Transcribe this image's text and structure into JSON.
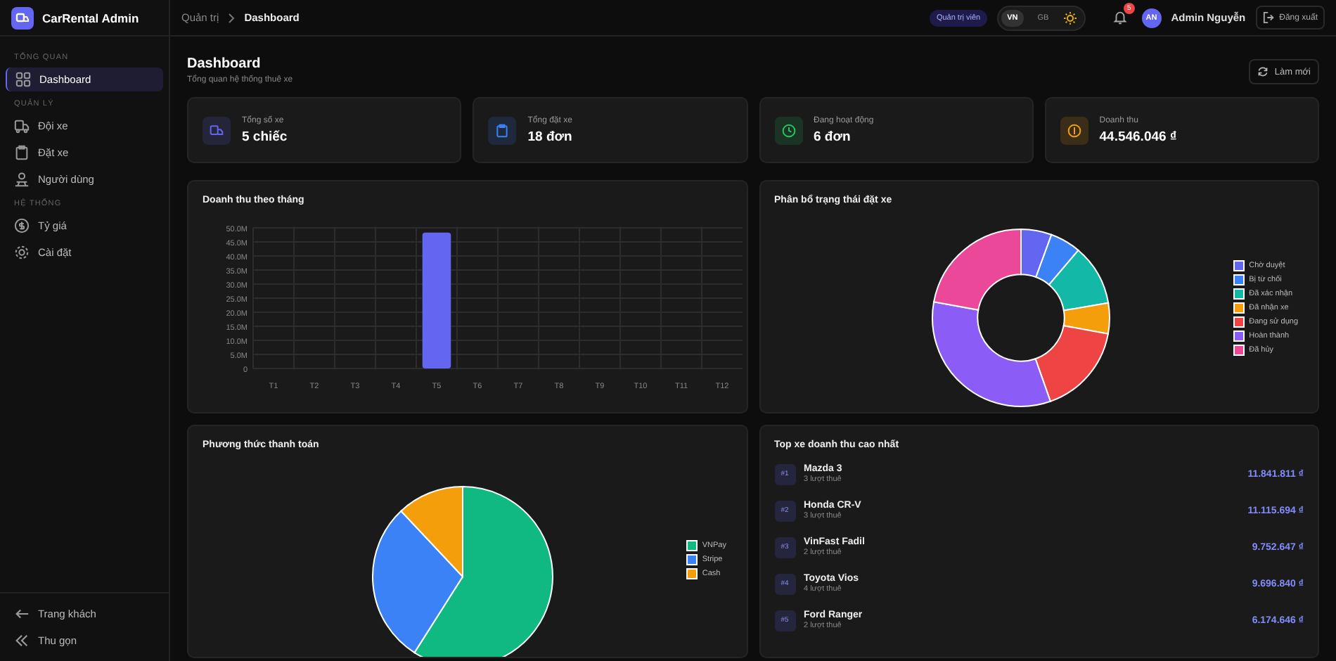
{
  "sidebar": {
    "brand": "CarRental Admin",
    "sections": [
      {
        "title": "TỔNG QUAN",
        "items": [
          {
            "label": "Dashboard",
            "selected": true
          }
        ]
      },
      {
        "title": "QUẢN LÝ",
        "items": [
          {
            "label": "Đội xe",
            "selected": false
          },
          {
            "label": "Đặt xe",
            "selected": false
          },
          {
            "label": "Người dùng",
            "selected": false
          }
        ]
      },
      {
        "title": "HỆ THỐNG",
        "items": [
          {
            "label": "Tỷ giá",
            "selected": false
          },
          {
            "label": "Cài đặt",
            "selected": false
          }
        ]
      }
    ],
    "footer": [
      "Trang khách",
      "Thu gọn"
    ]
  },
  "breadcrumb": [
    "Quản trị",
    "Dashboard"
  ],
  "header": {
    "role": "Quản trị viên",
    "languages": [
      {
        "label": "VN",
        "selected": true
      },
      {
        "label": "GB",
        "selected": false
      }
    ],
    "notifications": "5",
    "avatar": "AN",
    "user": "Admin Nguyễn",
    "logout": "Đăng xuất"
  },
  "page": {
    "title": "Dashboard",
    "subtitle": "Tổng quan hệ thống thuê xe",
    "refresh": "Làm mới"
  },
  "stats": [
    {
      "label": "Tổng số xe",
      "value": "5 chiếc",
      "color": "#6366f1"
    },
    {
      "label": "Tổng đặt xe",
      "value": "18 đơn",
      "color": "#3b82f6"
    },
    {
      "label": "Đang hoạt động",
      "value": "6 đơn",
      "color": "#22c55e"
    },
    {
      "label": "Doanh thu",
      "value": "44.546.046 ₫",
      "color": "#f59e0b"
    }
  ],
  "revenue_chart": {
    "chart_data": {
      "type": "bar",
      "title": "Doanh thu theo tháng",
      "grid": true,
      "categories": [
        "T1",
        "T2",
        "T3",
        "T4",
        "T5",
        "T6",
        "T7",
        "T8",
        "T9",
        "T10",
        "T11",
        "T12"
      ],
      "values": [
        0,
        0,
        0,
        0,
        48.3,
        0,
        0,
        0,
        0,
        0,
        0,
        0
      ],
      "ylim": [
        0,
        50
      ],
      "yticks": [
        {
          "value": 0,
          "label": "0"
        },
        {
          "value": 5,
          "label": "5.0M"
        },
        {
          "value": 10,
          "label": "10.0M"
        },
        {
          "value": 15,
          "label": "15.0M"
        },
        {
          "value": 20,
          "label": "20.0M"
        },
        {
          "value": 25,
          "label": "25.0M"
        },
        {
          "value": 30,
          "label": "30.0M"
        },
        {
          "value": 35,
          "label": "35.0M"
        },
        {
          "value": 40,
          "label": "40.0M"
        },
        {
          "value": 45,
          "label": "45.0M"
        },
        {
          "value": 50,
          "label": "50.0M"
        }
      ]
    }
  },
  "status_chart": {
    "chart_data": {
      "type": "donut",
      "title": "Phân bổ trạng thái đặt xe",
      "categories": [
        "Chờ duyệt",
        "Bị từ chối",
        "Đã xác nhận",
        "Đã nhận xe",
        "Đang sử dụng",
        "Hoàn thành",
        "Đã hủy"
      ],
      "values": [
        5.6,
        5.6,
        11.1,
        5.6,
        16.7,
        33.3,
        22.1
      ]
    },
    "legend": [
      {
        "color": "#6366f1"
      },
      {
        "color": "#3b82f6"
      },
      {
        "color": "#14b8a6"
      },
      {
        "color": "#f59e0b"
      },
      {
        "color": "#ef4444"
      },
      {
        "color": "#8b5cf6"
      },
      {
        "color": "#ec4899"
      }
    ]
  },
  "payment_chart": {
    "chart_data": {
      "type": "pie",
      "title": "Phương thức thanh toán",
      "categories": [
        "VNPay",
        "Stripe",
        "Cash"
      ],
      "values": [
        59,
        29,
        12
      ]
    },
    "legend": [
      {
        "color": "#10b981"
      },
      {
        "color": "#3b82f6"
      },
      {
        "color": "#f59e0b"
      }
    ]
  },
  "top_cars": {
    "title": "Top xe doanh thu cao nhất",
    "items": [
      {
        "rank": "#1",
        "name": "Mazda 3",
        "rentals": "3 lượt thuê",
        "revenue": "11.841.811 ₫"
      },
      {
        "rank": "#2",
        "name": "Honda CR-V",
        "rentals": "3 lượt thuê",
        "revenue": "11.115.694 ₫"
      },
      {
        "rank": "#3",
        "name": "VinFast Fadil",
        "rentals": "2 lượt thuê",
        "revenue": "9.752.647 ₫"
      },
      {
        "rank": "#4",
        "name": "Toyota Vios",
        "rentals": "4 lượt thuê",
        "revenue": "9.696.840 ₫"
      },
      {
        "rank": "#5",
        "name": "Ford Ranger",
        "rentals": "2 lượt thuê",
        "revenue": "6.174.646 ₫"
      }
    ]
  }
}
